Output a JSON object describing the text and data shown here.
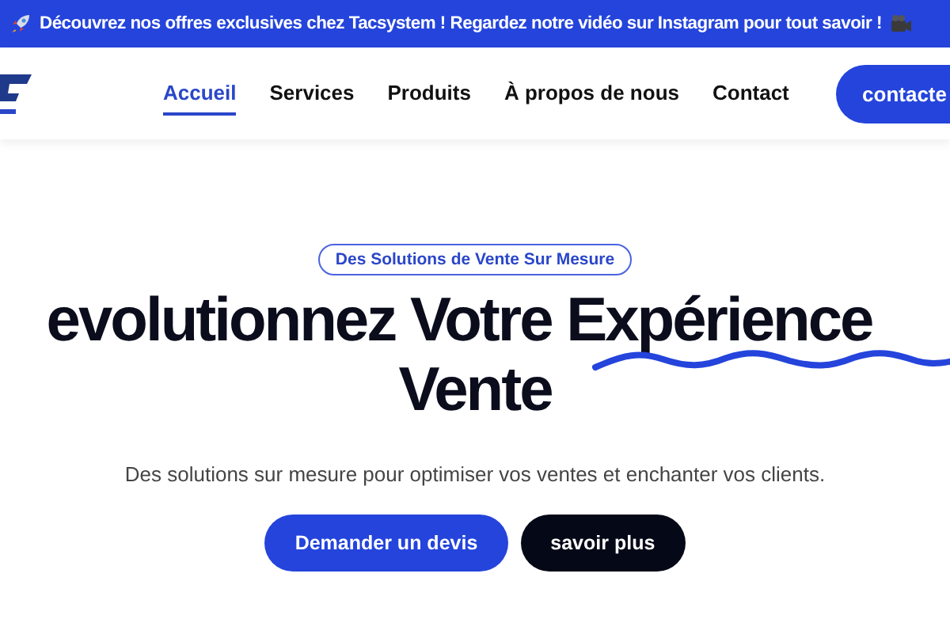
{
  "announcement": {
    "text": "Découvrez nos offres exclusives chez Tacsystem ! Regardez notre vidéo sur Instagram pour tout savoir !"
  },
  "nav": {
    "items": [
      {
        "label": "Accueil",
        "selected": true
      },
      {
        "label": "Services",
        "selected": false
      },
      {
        "label": "Produits",
        "selected": false
      },
      {
        "label": "À propos de nous",
        "selected": false
      },
      {
        "label": "Contact",
        "selected": false
      }
    ],
    "cta": "contacte"
  },
  "hero": {
    "badge": "Des Solutions de Vente Sur Mesure",
    "title_line_1": "evolutionnez Votre Expérience",
    "title_line_2": "Vente",
    "subtitle": "Des solutions sur mesure pour optimiser vos ventes et enchanter vos clients.",
    "buttons": [
      {
        "label": "Demander un devis",
        "kind": "primary"
      },
      {
        "label": "savoir plus",
        "kind": "dark"
      }
    ]
  }
}
